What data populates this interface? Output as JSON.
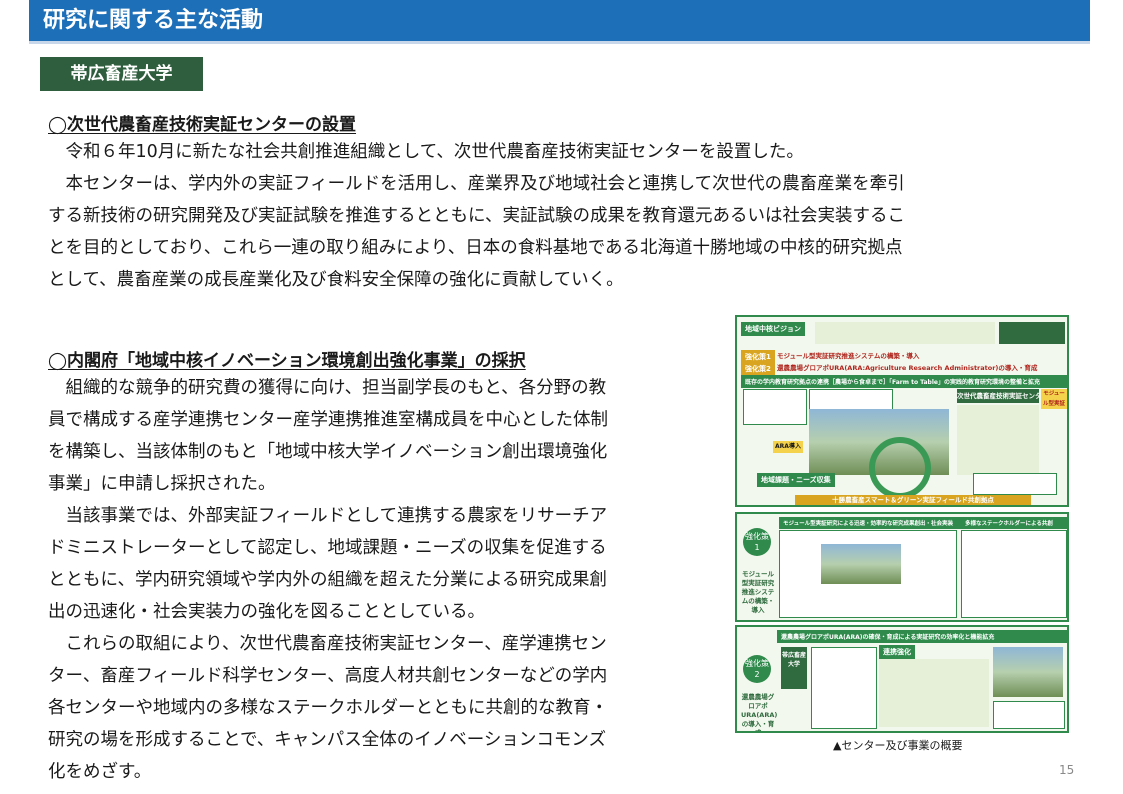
{
  "header": {
    "title": "研究に関する主な活動"
  },
  "badge": "帯広畜産大学",
  "section1": {
    "heading": "◯次世代農畜産技術実証センターの設置",
    "lines": [
      "令和６年10月に新たな社会共創推進組織として、次世代農畜産技術実証センターを設置した。",
      "本センターは、学内外の実証フィールドを活用し、産業界及び地域社会と連携して次世代の農畜産業を牽引",
      "する新技術の研究開発及び実証試験を推進するとともに、実証試験の成果を教育還元あるいは社会実装するこ",
      "とを目的としており、これら一連の取り組みにより、日本の食料基地である北海道十勝地域の中核的研究拠点",
      "として、農畜産業の成長産業化及び食料安全保障の強化に貢献していく。"
    ]
  },
  "section2": {
    "heading": "◯内閣府「地域中核イノベーション環境創出強化事業」の採択",
    "lines": [
      "組織的な競争的研究費の獲得に向け、担当副学長のもと、各分野の教",
      "員で構成する産学連携センター産学連携推進室構成員を中心とした体制",
      "を構築し、当該体制のもと「地域中核大学イノベーション創出環境強化",
      "事業」に申請し採択された。",
      "当該事業では、外部実証フィールドとして連携する農家をリサーチア",
      "ドミニストレーターとして認定し、地域課題・ニーズの収集を促進する",
      "とともに、学内研究領域や学内外の組織を超えた分業による研究成果創",
      "出の迅速化・社会実装力の強化を図ることとしている。",
      "これらの取組により、次世代農畜産技術実証センター、産学連携セン",
      "ター、畜産フィールド科学センター、高度人材共創センターなどの学内",
      "各センターや地域内の多様なステークホルダーとともに共創的な教育・",
      "研究の場を形成することで、キャンパス全体のイノベーションコモンズ",
      "化をめざす。"
    ]
  },
  "figure": {
    "panel1": {
      "vision_tag": "地域中核ビジョン",
      "strengthen1": "強化策1",
      "module_system": "モジュール型実証研究推進システムの構築・導入",
      "strengthen2": "強化策2",
      "ura_line": "還農農場グロアポURA(ARA:Agriculture Research Administrator)の導入・育成",
      "base_line": "既存の学内教育研究拠点の連携［農場から食卓まで］「Farm to Table」の実践的教育研究環境の整備と拡充",
      "center_title": "次世代農畜産技術実証センター",
      "ara_tag": "ARA導入",
      "field_line": "十勝農畜産スマート＆グリーン実証フィールド共創拠点",
      "needs_tag": "地域課題・ニーズ収集",
      "module_badge": "モジュール型実証研究導入"
    },
    "panel2": {
      "number_label": "強化策\n1",
      "side_label": "モジュール型実証研究推進システムの構築・導入",
      "header": "モジュール型実証研究による迅速・効率的な研究成果創出・社会実装",
      "right_header": "多様なステークホルダーによる共創"
    },
    "panel3": {
      "number_label": "強化策\n2",
      "side_label": "還農農場グロアポURA(ARA)の導入・育成",
      "header": "還農農場グロアポURA(ARA)の確保・育成による実証研究の効率化と機能拡充",
      "univ_label": "帯広畜産大学",
      "collab_label": "連携強化"
    }
  },
  "caption": "▲センター及び事業の概要",
  "page_number": "15"
}
